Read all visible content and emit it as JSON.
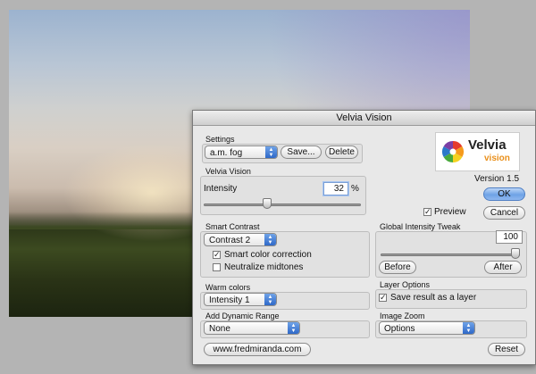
{
  "window": {
    "title": "Velvia Vision"
  },
  "logo": {
    "brand_top": "Velvia",
    "brand_bottom": "vision"
  },
  "version": "Version 1.5",
  "buttons": {
    "ok": "OK",
    "cancel": "Cancel",
    "before": "Before",
    "after": "After",
    "reset": "Reset"
  },
  "settings": {
    "label": "Settings",
    "selected": "a.m. fog",
    "save": "Save...",
    "delete": "Delete"
  },
  "velvia_vision": {
    "label": "Velvia Vision",
    "intensity_label": "Intensity",
    "intensity_value": "32",
    "unit": "%",
    "slider_fraction": 0.32
  },
  "preview": {
    "label": "Preview",
    "checked": true
  },
  "smart_contrast": {
    "label": "Smart Contrast",
    "selected": "Contrast 2",
    "smart_color_correction": {
      "label": "Smart color correction",
      "checked": true
    },
    "neutralize_midtones": {
      "label": "Neutralize midtones",
      "checked": false
    }
  },
  "global_intensity": {
    "label": "Global Intensity Tweak",
    "value": "100",
    "slider_fraction": 1.0
  },
  "warm_colors": {
    "label": "Warm colors",
    "selected": "Intensity 1"
  },
  "layer_options": {
    "label": "Layer Options",
    "save_as_layer": {
      "label": "Save result as a layer",
      "checked": true
    }
  },
  "dynamic_range": {
    "label": "Add Dynamic Range",
    "selected": "None"
  },
  "image_zoom": {
    "label": "Image Zoom",
    "selected": "Options"
  },
  "website": "www.fredmiranda.com",
  "colors": {
    "accent": "#3a72cf",
    "dialog_bg": "#e8e8e8"
  }
}
